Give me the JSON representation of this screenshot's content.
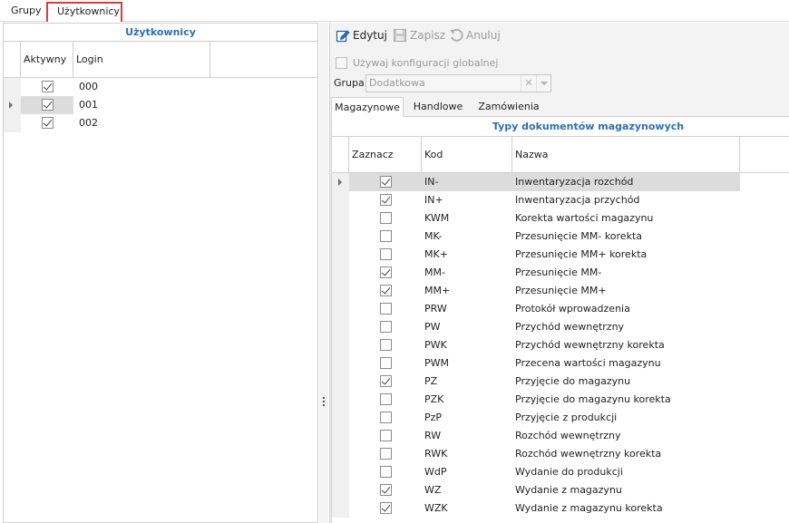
{
  "top_tabs": [
    {
      "label": "Grupy"
    },
    {
      "label": "Użytkownicy"
    }
  ],
  "users_panel": {
    "title": "Użytkownicy",
    "columns": {
      "active": "Aktywny",
      "login": "Login"
    },
    "rows": [
      {
        "active": true,
        "login": "000"
      },
      {
        "active": true,
        "login": "001",
        "selected": true
      },
      {
        "active": true,
        "login": "002"
      }
    ]
  },
  "toolbar": {
    "edit_label": "Edytuj",
    "save_label": "Zapisz",
    "cancel_label": "Anuluj"
  },
  "global_config": {
    "label": "Używaj konfiguracji globalnej",
    "checked": false
  },
  "group": {
    "label": "Grupa",
    "value": "Dodatkowa"
  },
  "sub_tabs": [
    {
      "label": "Magazynowe",
      "active": true
    },
    {
      "label": "Handlowe"
    },
    {
      "label": "Zamówienia"
    }
  ],
  "doc_types": {
    "title": "Typy dokumentów magazynowych",
    "columns": {
      "check": "Zaznacz",
      "code": "Kod",
      "name": "Nazwa"
    },
    "rows": [
      {
        "checked": true,
        "code": "IN-",
        "name": "Inwentaryzacja rozchód",
        "selected": true
      },
      {
        "checked": true,
        "code": "IN+",
        "name": "Inwentaryzacja przychód"
      },
      {
        "checked": false,
        "code": "KWM",
        "name": "Korekta wartości magazynu"
      },
      {
        "checked": false,
        "code": "MK-",
        "name": "Przesunięcie MM- korekta"
      },
      {
        "checked": false,
        "code": "MK+",
        "name": "Przesunięcie MM+ korekta"
      },
      {
        "checked": true,
        "code": "MM-",
        "name": "Przesunięcie MM-"
      },
      {
        "checked": true,
        "code": "MM+",
        "name": "Przesunięcie MM+"
      },
      {
        "checked": false,
        "code": "PRW",
        "name": "Protokół wprowadzenia"
      },
      {
        "checked": false,
        "code": "PW",
        "name": "Przychód wewnętrzny"
      },
      {
        "checked": false,
        "code": "PWK",
        "name": "Przychód wewnętrzny korekta"
      },
      {
        "checked": false,
        "code": "PWM",
        "name": "Przecena wartości magazynu"
      },
      {
        "checked": true,
        "code": "PZ",
        "name": "Przyjęcie do magazynu"
      },
      {
        "checked": false,
        "code": "PZK",
        "name": "Przyjęcie do magazynu korekta"
      },
      {
        "checked": false,
        "code": "PzP",
        "name": "Przyjęcie z produkcji"
      },
      {
        "checked": false,
        "code": "RW",
        "name": "Rozchód wewnętrzny"
      },
      {
        "checked": false,
        "code": "RWK",
        "name": "Rozchód wewnętrzny korekta"
      },
      {
        "checked": false,
        "code": "WdP",
        "name": "Wydanie do produkcji"
      },
      {
        "checked": true,
        "code": "WZ",
        "name": "Wydanie z magazynu"
      },
      {
        "checked": true,
        "code": "WZK",
        "name": "Wydanie z magazynu korekta"
      }
    ]
  },
  "colors": {
    "title_blue": "#2e6fb7",
    "tab_highlight": "#e03a3a",
    "selected_row": "#dcdcdc"
  },
  "icons": {
    "edit": "edit-pencil-icon",
    "save": "floppy-disk-icon",
    "cancel": "undo-icon"
  }
}
